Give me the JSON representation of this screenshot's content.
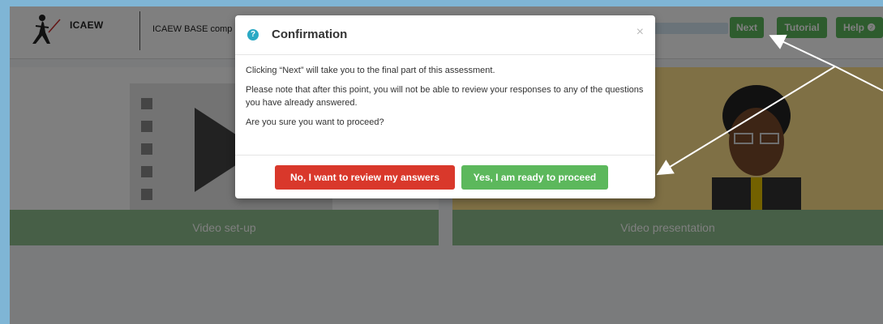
{
  "header": {
    "brand": "ICAEW",
    "app_title": "ICAEW BASE comp",
    "buttons": {
      "next": "Next",
      "tutorial": "Tutorial",
      "help": "Help ❷"
    }
  },
  "cards": [
    {
      "caption": "Video set-up"
    },
    {
      "caption": "Video presentation"
    }
  ],
  "modal": {
    "title": "Confirmation",
    "close": "×",
    "icon": "?",
    "paragraphs": [
      "Clicking “Next” will take you to the final part of this assessment.",
      "Please note that after this point, you will not be able to review your responses to any of the questions you have already answered.",
      "Are you sure you want to proceed?"
    ],
    "btn_review": "No, I want to review my answers",
    "btn_proceed": "Yes, I am ready to proceed"
  },
  "colors": {
    "accent_green": "#5cb85c",
    "danger_red": "#d9382b",
    "info_blue": "#2aa9c4",
    "border_blue": "#7fb5d5"
  }
}
